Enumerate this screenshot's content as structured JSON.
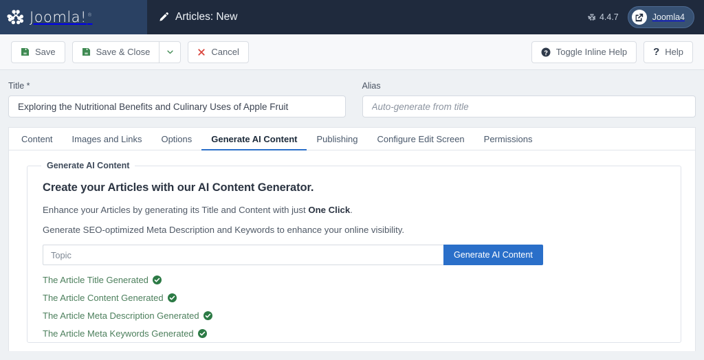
{
  "header": {
    "brand": {
      "name": "Joomla!",
      "tm": "®",
      "icon": "joomla-logo-icon"
    },
    "page_title": "Articles: New",
    "page_title_icon": "pencil-icon",
    "version": "4.4.7",
    "version_icon": "joomla-mark-icon",
    "site_pill": {
      "label": "Joomla4",
      "icon": "external-link-icon"
    }
  },
  "toolbar": {
    "save_label": "Save",
    "save_icon": "floppy-save-icon",
    "save_close_label": "Save & Close",
    "save_close_icon": "floppy-save-icon",
    "dropdown_icon": "chevron-down-icon",
    "cancel_label": "Cancel",
    "cancel_icon": "close-x-icon",
    "toggle_inline_help_label": "Toggle Inline Help",
    "toggle_inline_help_icon": "question-circle-icon",
    "help_label": "Help",
    "help_icon": "question-mark-icon"
  },
  "fields": {
    "title_label": "Title *",
    "title_value": "Exploring the Nutritional Benefits and Culinary Uses of Apple Fruit",
    "title_placeholder": "",
    "alias_label": "Alias",
    "alias_value": "",
    "alias_placeholder": "Auto-generate from title"
  },
  "tabs": [
    {
      "label": "Content",
      "active": false
    },
    {
      "label": "Images and Links",
      "active": false
    },
    {
      "label": "Options",
      "active": false
    },
    {
      "label": "Generate AI Content",
      "active": true
    },
    {
      "label": "Publishing",
      "active": false
    },
    {
      "label": "Configure Edit Screen",
      "active": false
    },
    {
      "label": "Permissions",
      "active": false
    }
  ],
  "ai_panel": {
    "legend": "Generate AI Content",
    "heading": "Create your Articles with our AI Content Generator.",
    "para1_before": "Enhance your Articles by generating its Title and Content with just ",
    "para1_bold": "One Click",
    "para1_after": ".",
    "para2": "Generate SEO-optimized Meta Description and Keywords to enhance your online visibility.",
    "topic_placeholder": "Topic",
    "topic_value": "",
    "generate_button": "Generate AI Content",
    "status_icon": "check-circle-icon",
    "status_lines": [
      "The Article Title Generated",
      "The Article Content Generated",
      "The Article Meta Description Generated",
      "The Article Meta Keywords Generated"
    ]
  },
  "colors": {
    "brand_navy": "#2a4163",
    "header_navy": "#1f2a3d",
    "accent_blue": "#2a6fc9",
    "success_green": "#4c7f5c",
    "save_green": "#3f8a52",
    "danger_red": "#d9453c",
    "page_bg": "#eef1f4"
  }
}
